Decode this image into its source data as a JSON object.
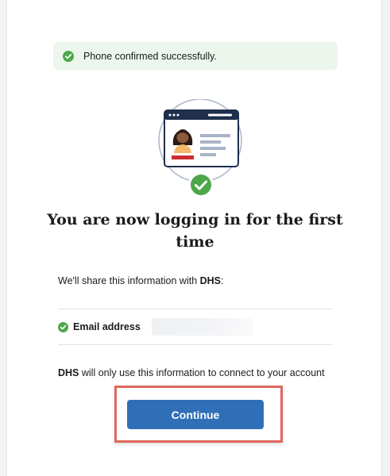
{
  "alert": {
    "message": "Phone confirmed successfully.",
    "icon": "check-circle-icon",
    "background": "#ecf6ec",
    "icon_color": "#4ca84a"
  },
  "hero": {
    "icon": "id-card-verified-icon"
  },
  "heading": "You are now logging in for the first time",
  "share": {
    "intro_prefix": "We'll share this information with ",
    "agency": "DHS",
    "intro_suffix": ":"
  },
  "attributes": [
    {
      "label": "Email address",
      "icon": "check-circle-icon"
    }
  ],
  "usage": {
    "agency": "DHS",
    "text": " will only use this information to connect to your account"
  },
  "continue_button": {
    "label": "Continue",
    "color": "#2f6fb8"
  },
  "highlight_color": "#e0675c"
}
